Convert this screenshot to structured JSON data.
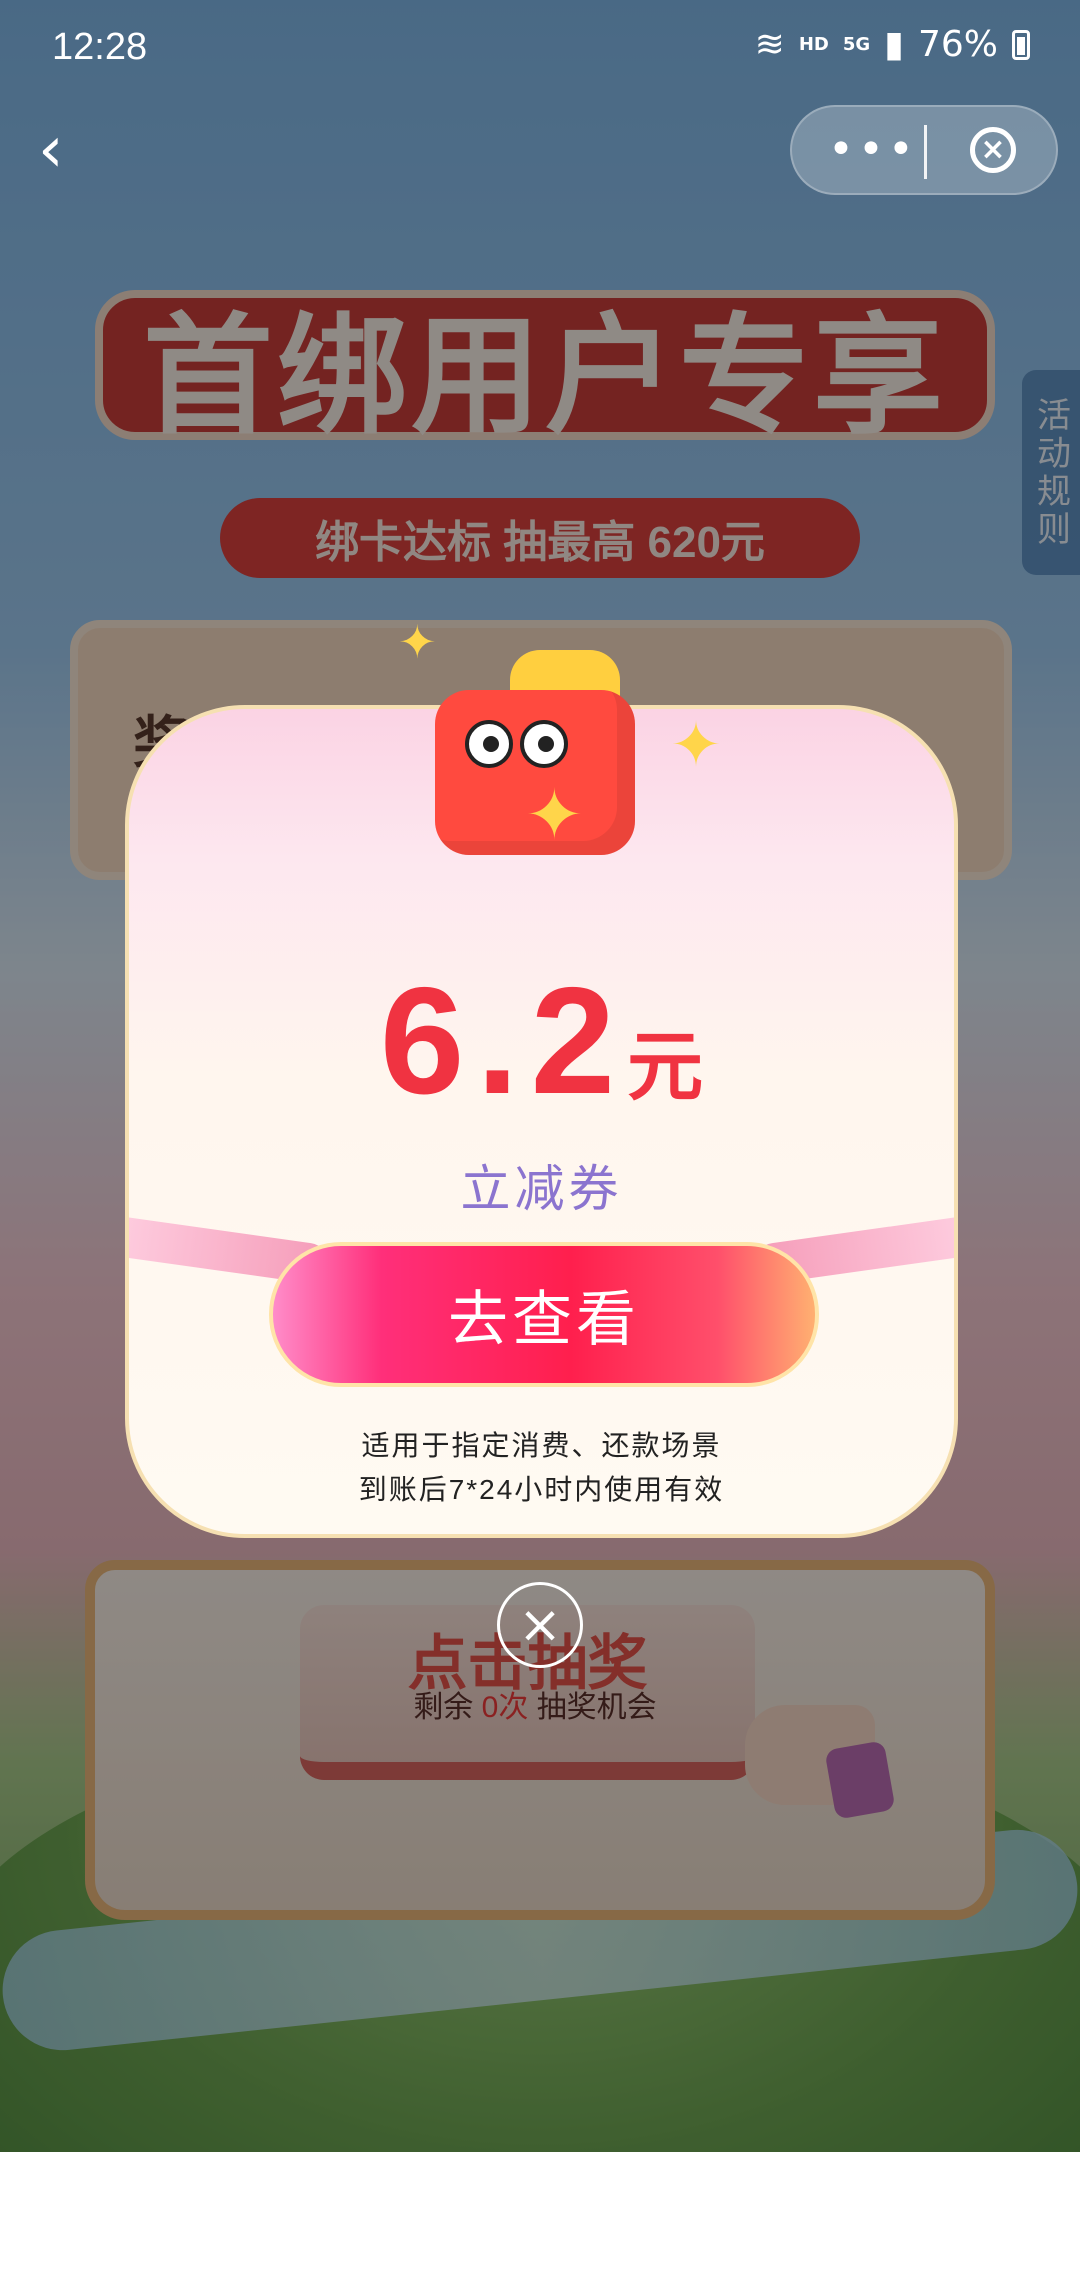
{
  "status_bar": {
    "time": "12:28",
    "hd": "HD",
    "signal": "5G",
    "battery": "76%"
  },
  "nav": {
    "back_icon": "chevron-left-icon",
    "more_icon": "more-icon",
    "close_icon": "close-circle-icon"
  },
  "background": {
    "headline": "首绑用户专享",
    "subheadline": "绑卡达标 抽最高 620元",
    "rules_tab": "活动规则",
    "prize_card_label": "奖励",
    "draw_button": {
      "title": "点击抽奖",
      "remaining_prefix": "剩余",
      "remaining_count": "0次",
      "remaining_suffix": "抽奖机会"
    }
  },
  "modal": {
    "amount": "6.2",
    "unit": "元",
    "coupon_type": "立减券",
    "cta": "去查看",
    "note_line1": "适用于指定消费、还款场景",
    "note_line2": "到账后7*24小时内使用有效",
    "close_icon": "close-icon"
  }
}
